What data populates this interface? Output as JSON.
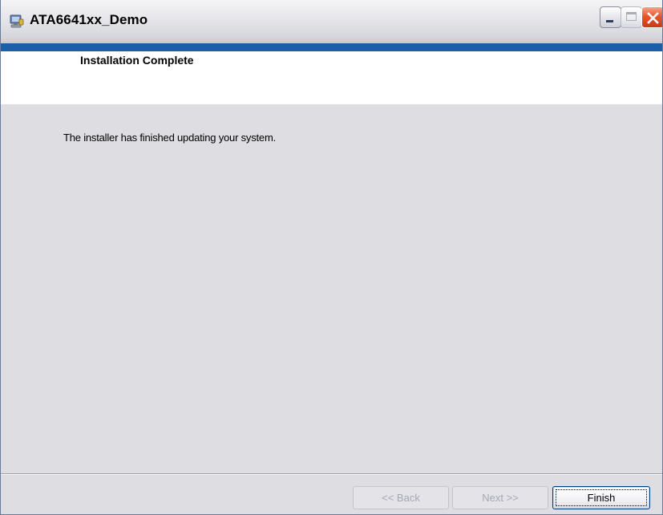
{
  "window": {
    "title": "ATA6641xx_Demo",
    "app_icon": "installer-computer-icon"
  },
  "titlebar_controls": {
    "minimize_icon": "minimize-icon",
    "maximize_icon": "maximize-icon",
    "close_icon": "close-icon"
  },
  "banner": {
    "title": "Installation Complete"
  },
  "content": {
    "message": "The installer has finished updating your system."
  },
  "footer": {
    "back_label": "<< Back",
    "next_label": "Next >>",
    "finish_label": "Finish",
    "back_enabled": false,
    "next_enabled": false,
    "finish_enabled": true
  },
  "colors": {
    "accent_strip": "#1c5ea8",
    "dialog_background": "#dddde2",
    "banner_background": "#ffffff",
    "close_button": "#e4572f"
  }
}
